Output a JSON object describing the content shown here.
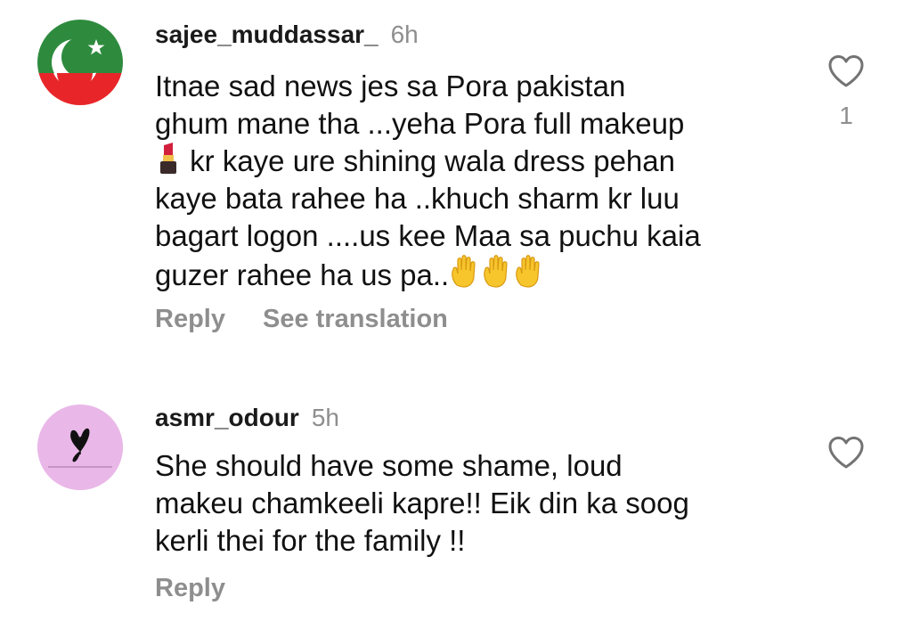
{
  "comments": [
    {
      "username": "sajee_muddassar_",
      "timestamp": "6h",
      "lines": [
        "Itnae sad news jes sa Pora pakistan",
        "ghum mane tha ...yeha Pora full makeup",
        " kr kaye ure shining wala dress pehan",
        "kaye bata rahee ha ..khuch sharm kr luu",
        "bagart logon ....us kee Maa sa puchu kaia",
        "guzer rahee ha us pa.."
      ],
      "inline_icons": [
        "lipstick-emoji",
        "raised-hand-emoji",
        "raised-hand-emoji",
        "raised-hand-emoji"
      ],
      "like_count": "1",
      "actions": {
        "reply": "Reply",
        "translate": "See translation"
      },
      "avatar_icon": "crescent-star-flag-avatar",
      "colors": {
        "flag_green": "#2e8b3e",
        "flag_red": "#e8262a"
      }
    },
    {
      "username": "asmr_odour",
      "timestamp": "5h",
      "lines": [
        "She should have some shame, loud",
        "makeu chamkeeli kapre!! Eik din ka soog",
        "kerli thei for the family !!"
      ],
      "like_count": "",
      "actions": {
        "reply": "Reply"
      },
      "avatar_icon": "butterfly-avatar",
      "colors": {
        "avatar_bg": "#e9b8e8"
      }
    }
  ],
  "colors": {
    "meta_gray": "#8e8e8e",
    "text": "#111111"
  }
}
